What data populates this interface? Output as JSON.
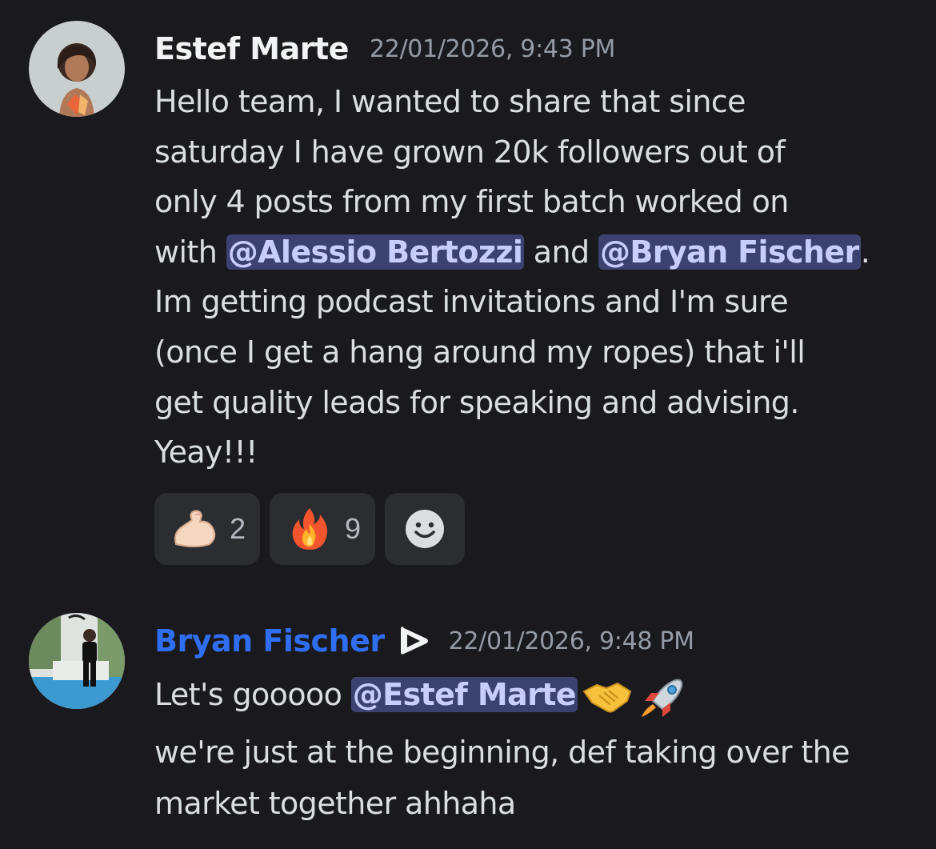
{
  "messages": [
    {
      "author": "Estef Marte",
      "timestamp": "22/01/2026, 9:43 PM",
      "lines": {
        "l1": "Hello team, I wanted to share that since",
        "l2": "saturday I have grown 20k followers out of",
        "l3": "only 4 posts from my first batch worked on",
        "l4_pre": "with ",
        "l4_mention1": "@Alessio Bertozzi",
        "l4_mid": " and ",
        "l4_mention2": "@Bryan Fischer",
        "l4_post": ".",
        "l5": "Im getting podcast invitations and I'm sure",
        "l6": "(once I get a hang around my ropes) that i'll",
        "l7": "get quality leads for speaking and advising.",
        "l8": "Yeay!!!"
      },
      "reactions": [
        {
          "emoji": "flexed-biceps",
          "count": "2"
        },
        {
          "emoji": "fire",
          "count": "9"
        }
      ],
      "add_reaction_icon": "smiley-add-reaction-icon"
    },
    {
      "author": "Bryan Fischer",
      "author_color": "#2f6ef0",
      "app_badge_icon": "play-badge-icon",
      "timestamp": "22/01/2026, 9:48 PM",
      "lines": {
        "l1_pre": "Let's gooooo ",
        "l1_mention": "@Estef Marte",
        "l1_emojis": [
          "handshake",
          "rocket"
        ],
        "l2": "we're just at the beginning, def taking over the",
        "l3": "market together ahhaha"
      }
    }
  ],
  "colors": {
    "background": "#1a1a1e",
    "mention_bg": "#3c4270",
    "mention_text": "#c9cdfb",
    "reaction_bg": "#2b2d31",
    "timestamp": "#949ba4"
  }
}
